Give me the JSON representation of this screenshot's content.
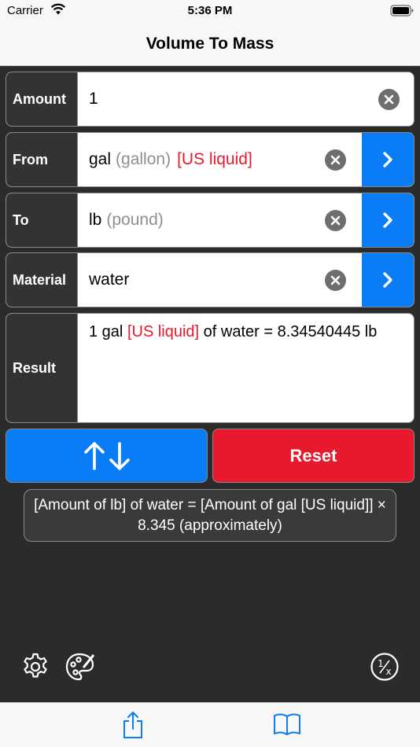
{
  "status_bar": {
    "carrier": "Carrier",
    "time": "5:36 PM"
  },
  "nav": {
    "title": "Volume To Mass"
  },
  "amount": {
    "label": "Amount",
    "value": "1"
  },
  "from": {
    "label": "From",
    "unit": "gal",
    "unit_name": "(gallon)",
    "qualifier": "[US liquid]"
  },
  "to": {
    "label": "To",
    "unit": "lb",
    "unit_name": "(pound)"
  },
  "material": {
    "label": "Material",
    "value": "water"
  },
  "result": {
    "label": "Result",
    "prefix": "1 gal ",
    "qualifier": "[US liquid]",
    "suffix": " of water = 8.34540445 lb"
  },
  "actions": {
    "reset_label": "Reset"
  },
  "formula": {
    "text": "[Amount of lb] of water = [Amount of gal [US liquid]] × 8.345 (approximately)"
  },
  "colors": {
    "accent_blue": "#0a7cf5",
    "danger_red": "#e8192c",
    "panel_dark": "#333333",
    "background": "#2b2b2b"
  },
  "icons": [
    "wifi-icon",
    "battery-icon",
    "clear-icon",
    "chevron-right-icon",
    "swap-arrows-icon",
    "gear-icon",
    "palette-icon",
    "reciprocal-icon",
    "share-icon",
    "book-icon"
  ]
}
